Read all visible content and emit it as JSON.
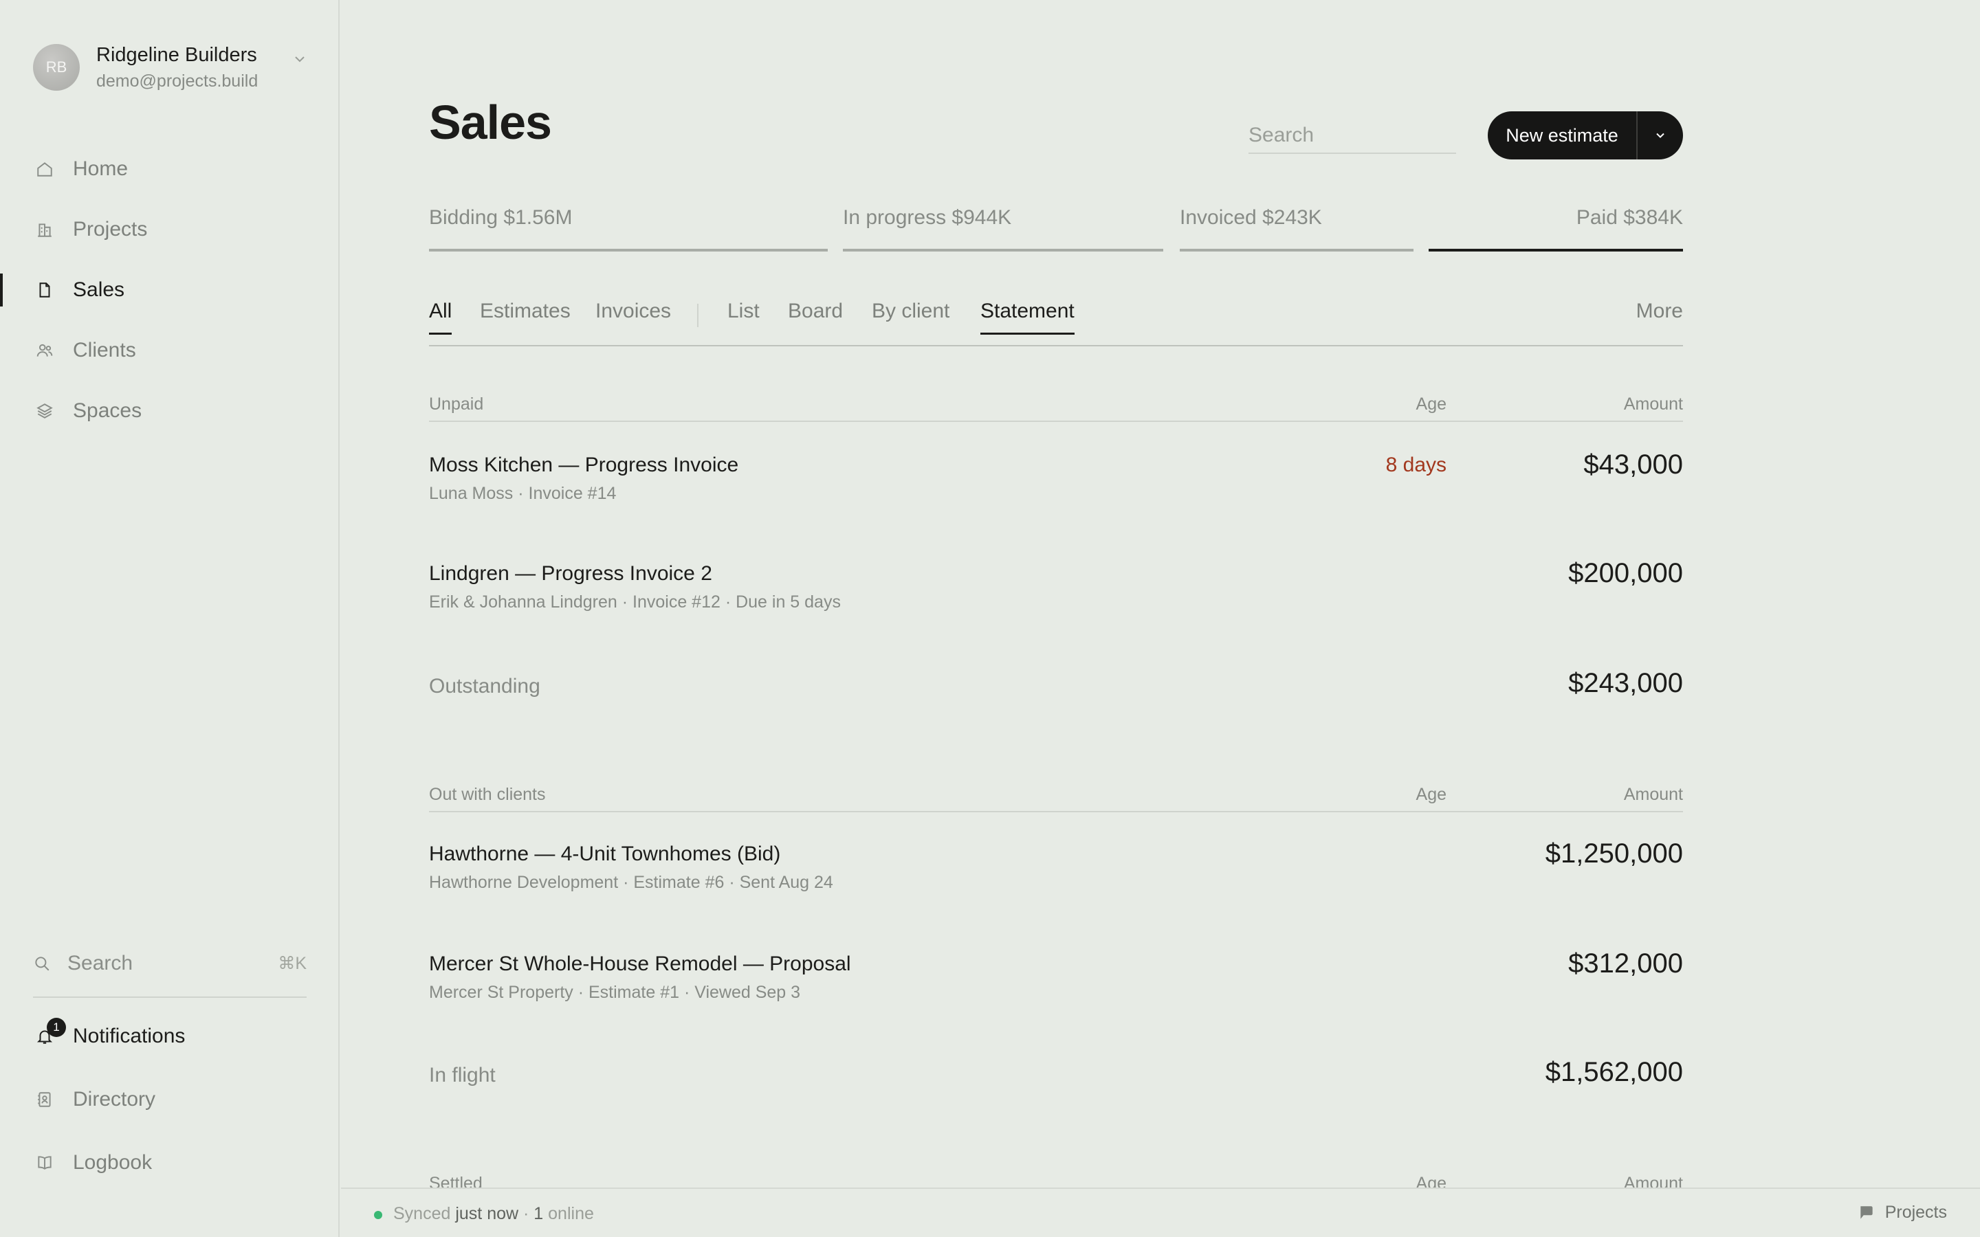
{
  "account": {
    "initials": "RB",
    "name": "Ridgeline Builders",
    "email": "demo@projects.build"
  },
  "nav": {
    "items": [
      {
        "label": "Home",
        "icon": "home-icon"
      },
      {
        "label": "Projects",
        "icon": "buildings-icon"
      },
      {
        "label": "Sales",
        "icon": "document-icon",
        "active": true
      },
      {
        "label": "Clients",
        "icon": "users-icon"
      },
      {
        "label": "Spaces",
        "icon": "layers-icon"
      }
    ],
    "search_label": "Search",
    "search_shortcut": "⌘K",
    "notifications_label": "Notifications",
    "notifications_count": "1",
    "directory_label": "Directory",
    "logbook_label": "Logbook"
  },
  "header": {
    "title": "Sales",
    "search_placeholder": "Search",
    "new_estimate_label": "New estimate"
  },
  "pipeline": [
    {
      "label": "Bidding $1.56M"
    },
    {
      "label": "In progress $944K"
    },
    {
      "label": "Invoiced $243K"
    },
    {
      "label": "Paid $384K",
      "current": true
    }
  ],
  "tabs": {
    "all": "All",
    "estimates": "Estimates",
    "invoices": "Invoices",
    "list": "List",
    "board": "Board",
    "by_client": "By client",
    "statement": "Statement",
    "more": "More"
  },
  "statement": {
    "unpaid": {
      "heading": "Unpaid",
      "age_header": "Age",
      "amount_header": "Amount",
      "rows": [
        {
          "title": "Moss Kitchen — Progress Invoice",
          "sub": "Luna Moss · Invoice #14",
          "age": "8 days",
          "amount": "$43,000"
        },
        {
          "title": "Lindgren — Progress Invoice 2",
          "sub": "Erik & Johanna Lindgren · Invoice #12 · Due in 5 days",
          "age": "",
          "amount": "$200,000"
        }
      ],
      "total_label": "Outstanding",
      "total_amount": "$243,000"
    },
    "out": {
      "heading": "Out with clients",
      "age_header": "Age",
      "amount_header": "Amount",
      "rows": [
        {
          "title": "Hawthorne — 4-Unit Townhomes (Bid)",
          "sub": "Hawthorne Development · Estimate #6 · Sent Aug 24",
          "age": "",
          "amount": "$1,250,000"
        },
        {
          "title": "Mercer St Whole-House Remodel — Proposal",
          "sub": "Mercer St Property · Estimate #1 · Viewed Sep 3",
          "age": "",
          "amount": "$312,000"
        }
      ],
      "total_label": "In flight",
      "total_amount": "$1,562,000"
    },
    "settled": {
      "heading": "Settled",
      "age_header": "Age",
      "amount_header": "Amount"
    }
  },
  "footer": {
    "synced_label": "Synced",
    "synced_time": "just now",
    "separator": "·",
    "online": "1",
    "online_label": "online",
    "right_label": "Projects"
  }
}
